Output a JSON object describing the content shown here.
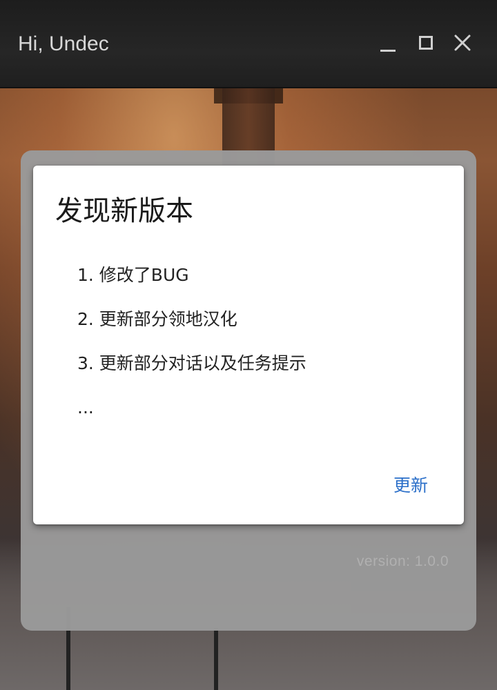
{
  "window": {
    "title": "Hi, Undec",
    "controls": {
      "minimize_icon": "minimize-icon",
      "maximize_icon": "maximize-icon",
      "close_icon": "close-icon",
      "close_glyph": "✕"
    }
  },
  "panel": {
    "version_text": "version: 1.0.0"
  },
  "dialog": {
    "title": "发现新版本",
    "changes": [
      "1. 修改了BUG",
      "2. 更新部分领地汉化",
      "3. 更新部分对话以及任务提示",
      "..."
    ],
    "update_label": "更新"
  },
  "colors": {
    "accent": "#2b6fc9",
    "titlebar": "#222222",
    "panel": "#9a9a9a"
  }
}
